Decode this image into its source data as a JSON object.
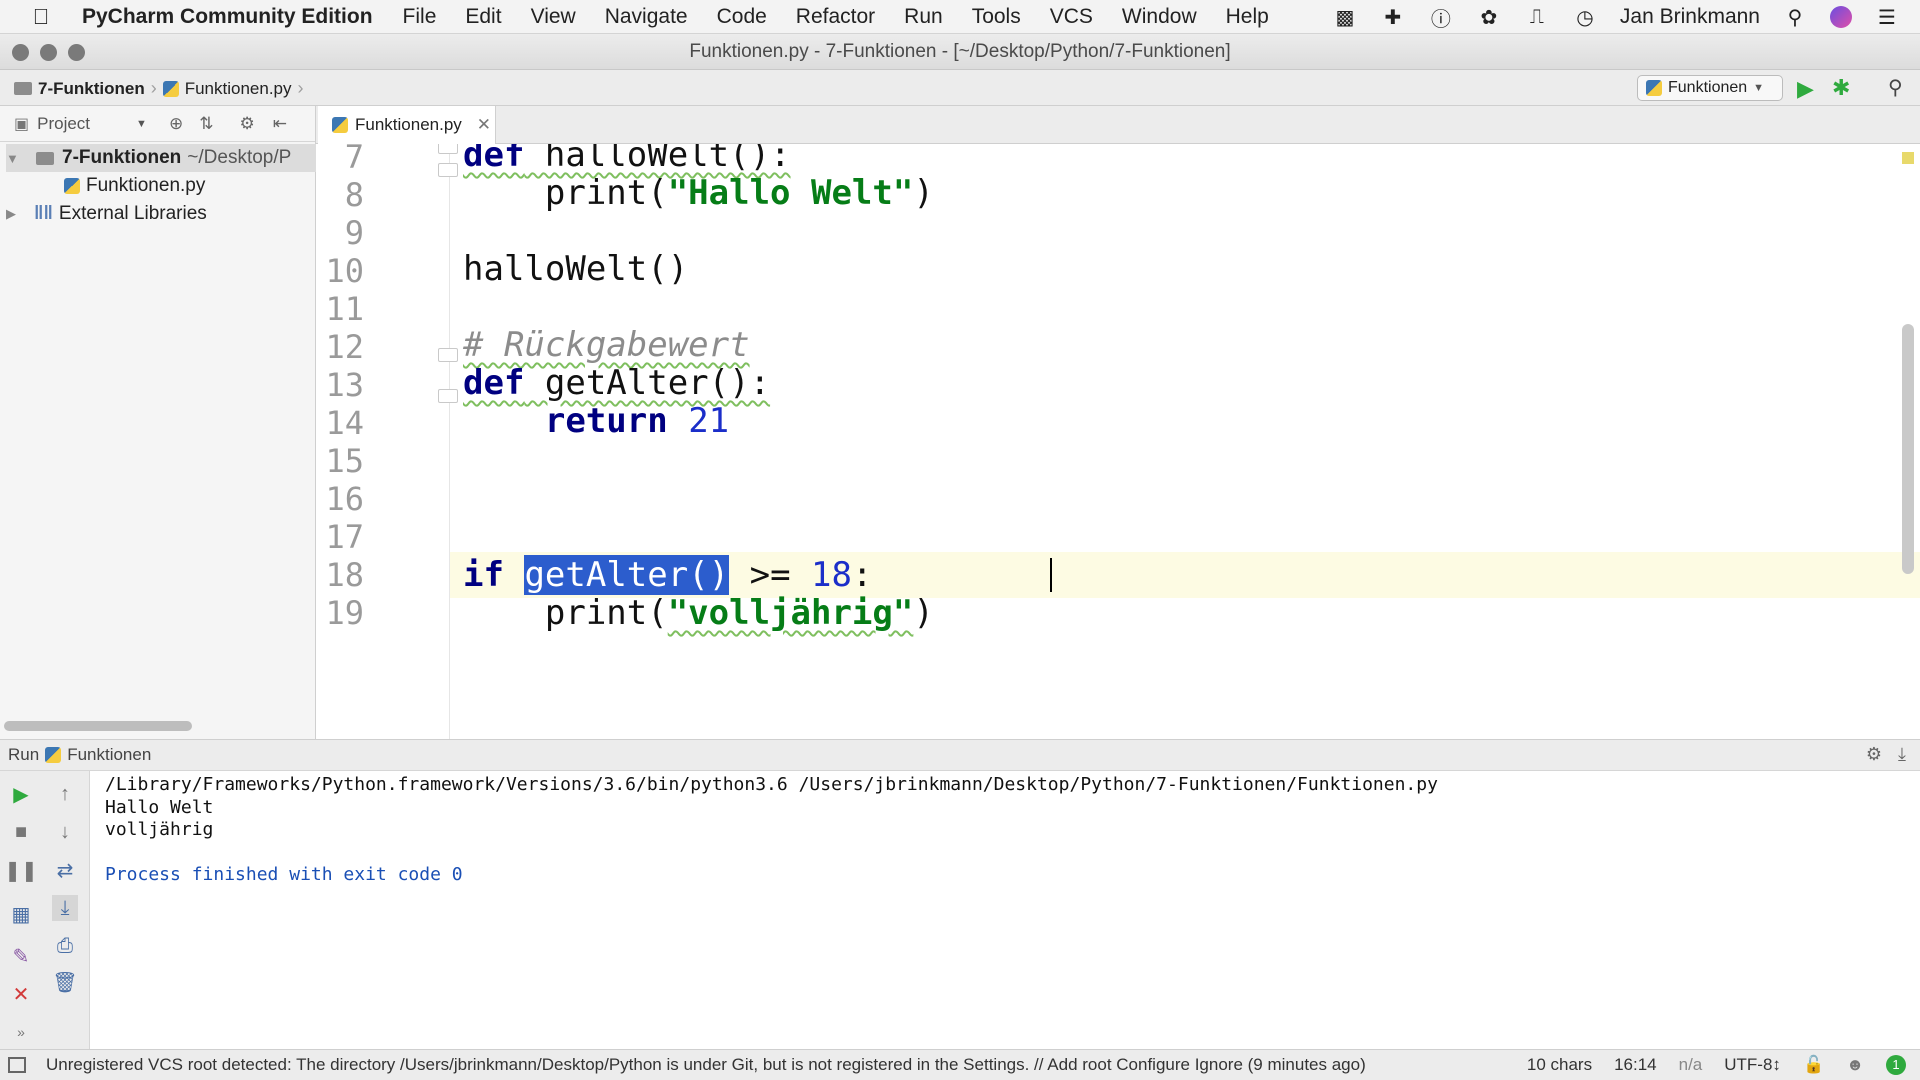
{
  "menubar": {
    "app_name": "PyCharm Community Edition",
    "menus": [
      "File",
      "Edit",
      "View",
      "Navigate",
      "Code",
      "Refactor",
      "Run",
      "Tools",
      "VCS",
      "Window",
      "Help"
    ],
    "user": "Jan Brinkmann"
  },
  "window": {
    "title": "Funktionen.py - 7-Funktionen - [~/Desktop/Python/7-Funktionen]"
  },
  "navbar": {
    "crumb_project": "7-Funktionen",
    "crumb_file": "Funktionen.py",
    "run_config": "Funktionen"
  },
  "project_panel": {
    "header": "Project",
    "root_name": "7-Funktionen",
    "root_path": "~/Desktop/P",
    "file": "Funktionen.py",
    "external": "External Libraries"
  },
  "editor": {
    "tab_label": "Funktionen.py",
    "line_numbers": [
      "7",
      "8",
      "9",
      "10",
      "11",
      "12",
      "13",
      "14",
      "15",
      "16",
      "17",
      "18",
      "19"
    ],
    "code": {
      "l7_kw": "def",
      "l7_rest": " halloWelt():",
      "l8_fn": "    print(",
      "l8_str": "\"Hallo Welt\"",
      "l8_end": ")",
      "l10": "halloWelt()",
      "l12": "# Rückgabewert",
      "l13_kw": "def",
      "l13_rest": " getAlter():",
      "l14_kw": "    return",
      "l14_num": "21",
      "l16_kw": "if",
      "l16_sel": "getAlter()",
      "l16_op": " >= ",
      "l16_num": "18",
      "l16_end": ":",
      "l17_fn": "    print(",
      "l17_str": "\"volljährig\"",
      "l17_end": ")"
    }
  },
  "run_panel": {
    "label": "Run",
    "config": "Funktionen",
    "output": [
      "/Library/Frameworks/Python.framework/Versions/3.6/bin/python3.6 /Users/jbrinkmann/Desktop/Python/7-Funktionen/Funktionen.py",
      "Hallo Welt",
      "volljährig",
      "",
      "Process finished with exit code 0"
    ]
  },
  "statusbar": {
    "message": "Unregistered VCS root detected: The directory /Users/jbrinkmann/Desktop/Python is under Git, but is not registered in the Settings. // Add root  Configure  Ignore (9 minutes ago)",
    "chars": "10 chars",
    "position": "16:14",
    "na": "n/a",
    "encoding": "UTF-8↕"
  },
  "colors": {
    "run_green": "#2faa3e",
    "selection": "#2c5dcd",
    "keyword": "#000080",
    "string": "#067d17",
    "number": "#1b2ec9"
  }
}
